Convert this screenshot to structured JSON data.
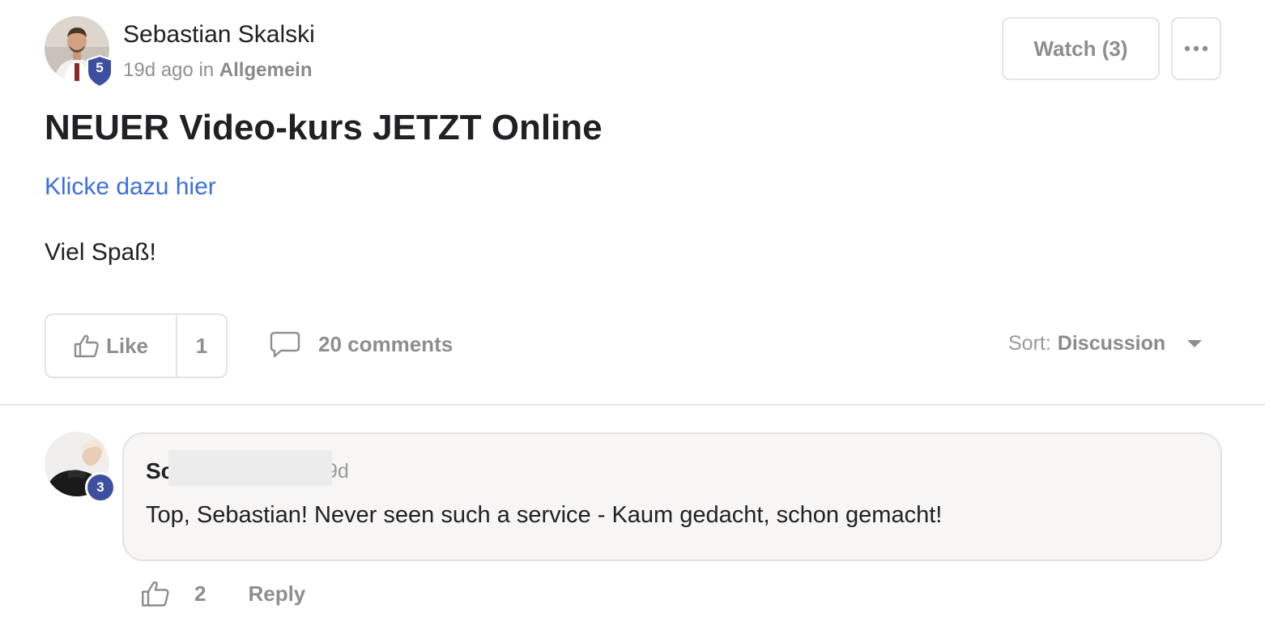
{
  "post": {
    "author_name": "Sebastian Skalski",
    "author_level": "5",
    "time_ago": "19d ago",
    "in_label": "in",
    "category": "Allgemein",
    "title": "NEUER Video-kurs JETZT Online",
    "link_text": "Klicke dazu hier",
    "body_text": "Viel Spaß!"
  },
  "header_actions": {
    "watch_label": "Watch (3)",
    "more_icon": "more-horizontal-icon"
  },
  "action_bar": {
    "like_label": "Like",
    "like_count": "1",
    "comments_label": "20 comments",
    "sort_label": "Sort:",
    "sort_value": "Discussion"
  },
  "comment": {
    "author_name_visible": "Sc",
    "author_level": "3",
    "time_visible": "9d",
    "text": "Top, Sebastian! Never seen such a service - Kaum gedacht, schon gemacht!",
    "like_count": "2",
    "reply_label": "Reply"
  },
  "colors": {
    "link": "#3a6fe0",
    "level_badge": "#3d4fa0",
    "muted_text": "#8e8e8e",
    "border": "#e4e4e4",
    "comment_bg": "#f7f6f5"
  }
}
